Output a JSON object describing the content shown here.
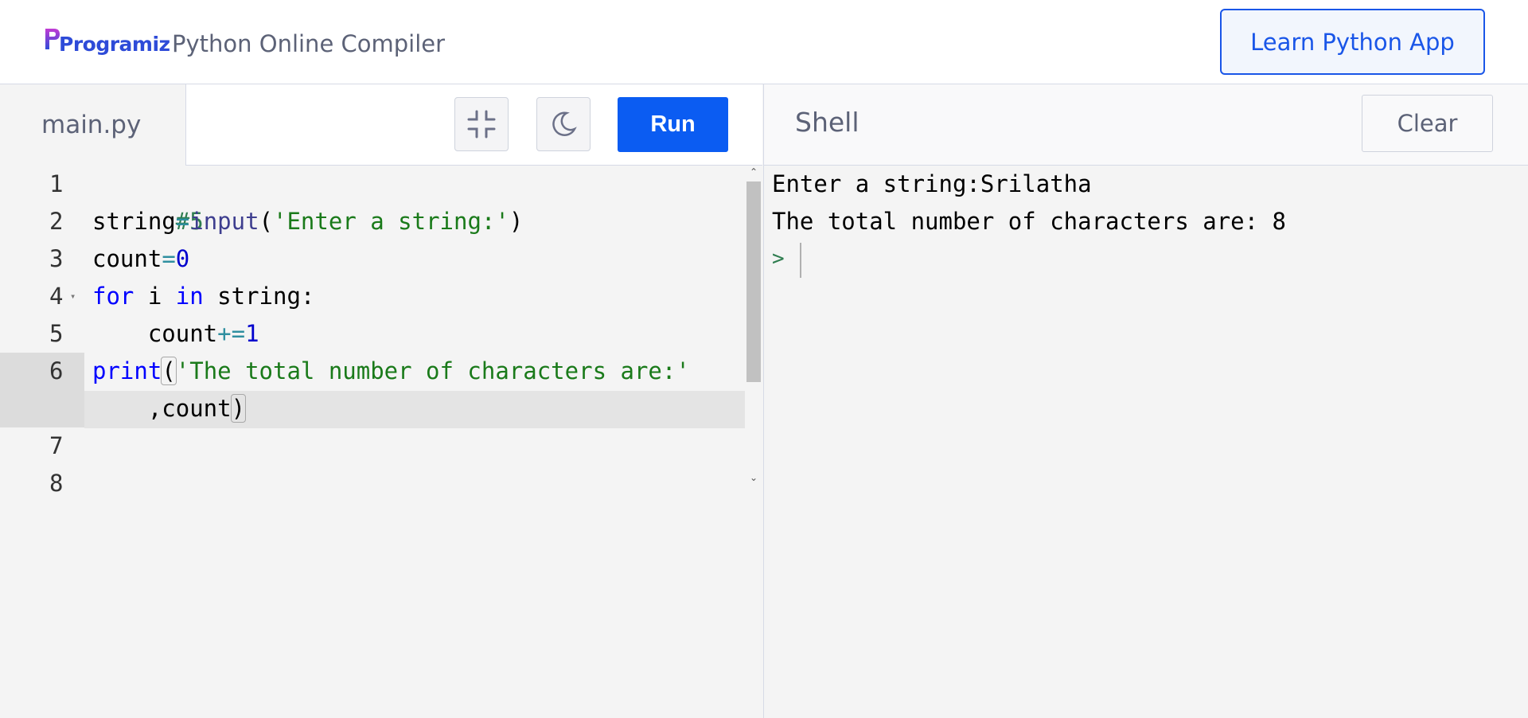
{
  "header": {
    "logo_text": "Programiz",
    "app_title": "Python Online Compiler",
    "learn_button": "Learn Python App"
  },
  "editor": {
    "file_tab": "main.py",
    "run_label": "Run",
    "line_numbers": [
      "1",
      "2",
      "3",
      "4",
      "5",
      "6",
      "7",
      "8"
    ],
    "lines": {
      "l1": {
        "comment": "#5"
      },
      "l2": {
        "var": "string",
        "op": "=",
        "fn": "input",
        "open": "(",
        "str": "'Enter a string:'",
        "close": ")"
      },
      "l3": {
        "var": "count",
        "op": "=",
        "num": "0"
      },
      "l4": {
        "kw1": "for",
        "mid1": " i ",
        "kw2": "in",
        "rest": " string:"
      },
      "l5": {
        "indent": "    ",
        "var": "count",
        "op": "+=",
        "num": "1"
      },
      "l6": {
        "fn": "print",
        "open": "(",
        "str": "'The total number of characters are:'"
      },
      "l6b": {
        "indent": "    ",
        "rest": ",count",
        "close": ")"
      }
    }
  },
  "shell": {
    "title": "Shell",
    "clear_label": "Clear",
    "output": [
      "Enter a string:Srilatha",
      "The total number of characters are: 8"
    ],
    "prompt": ">"
  },
  "colors": {
    "accent": "#0b5cf2",
    "keyword": "#0000ff",
    "string": "#1a7a1a",
    "number": "#0000cd",
    "comment": "#2e7d4f"
  }
}
